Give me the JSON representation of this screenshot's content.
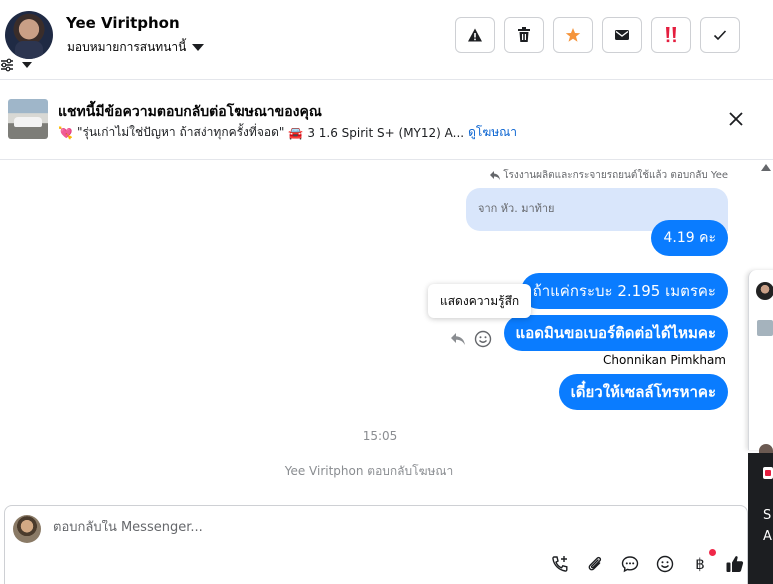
{
  "header": {
    "user_name": "Yee Viritphon",
    "assign_label": "มอบหมายการสนทนานี้",
    "actions": [
      {
        "name": "report-button",
        "icon": "warning-icon",
        "color": "#1c1e21"
      },
      {
        "name": "delete-button",
        "icon": "trash-icon",
        "color": "#1c1e21"
      },
      {
        "name": "star-button",
        "icon": "star-icon",
        "color": "#f5943b"
      },
      {
        "name": "mark-unread-button",
        "icon": "envelope-icon",
        "color": "#1c1e21"
      },
      {
        "name": "follow-up-button",
        "icon": "priority-icon",
        "color": "#e41e3f"
      },
      {
        "name": "mark-done-button",
        "icon": "check-icon",
        "color": "#1c1e21"
      }
    ]
  },
  "ad_banner": {
    "title": "แชทนี้มีข้อความตอบกลับต่อโฆษณาของคุณ",
    "heart": "💘",
    "caption": "\"รุ่นเก่าไม่ใช่ปัญหา ถ้าสง่าทุกครั้งที่จอด\"",
    "car": "🚘",
    "model": "3 1.6 Spirit S+ (MY12) A...",
    "link": "ดูโฆษณา"
  },
  "conversation": {
    "reply_note": "โรงงานผลิตและกระจายรถยนต์ใช้แล้ว ตอบกลับ Yee",
    "quoted_text": "จาก หัว. มาท้าย",
    "messages": [
      {
        "text": "4.19  คะ"
      },
      {
        "text": "ถ้าแค่กระบะ 2.195 เมตรคะ"
      },
      {
        "text": "แอดมินขอเบอร์ติดต่อได้ไหมคะ"
      },
      {
        "text": "เดี๋ยวให้เซลล์โทรหาคะ"
      }
    ],
    "reaction_tooltip": "แสดงความรู้สึก",
    "sender_name": "Chonnikan Pimkham",
    "timestamp": "15:05",
    "system_note": "Yee Viritphon ตอบกลับโฆษณา"
  },
  "side_panel": {
    "text_line1": "S",
    "text_line2": "A"
  },
  "composer": {
    "placeholder": "ตอบกลับใน Messenger...",
    "baht_symbol": "฿",
    "tools": [
      "call-add-icon",
      "attachment-icon",
      "saved-reply-icon",
      "emoji-icon",
      "payment-icon",
      "like-icon"
    ]
  }
}
